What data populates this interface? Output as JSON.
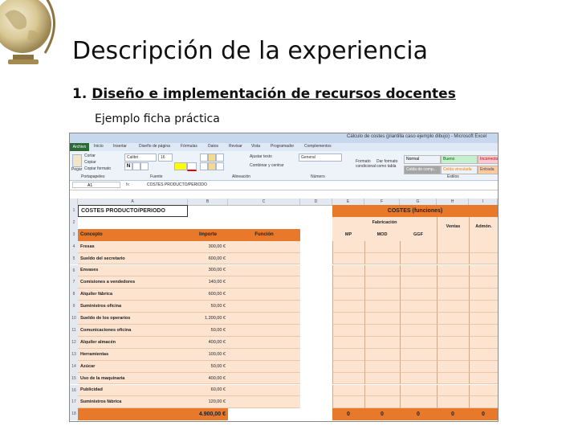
{
  "slide": {
    "title": "Descripción de la experiencia",
    "bullet_number": "1.",
    "bullet_text": "Diseño e implementación de recursos docentes",
    "subtitle": "Ejemplo ficha práctica"
  },
  "excel": {
    "window_title": "Cálculo de costes (plantilla caso ejemplo dibujo) - Microsoft Excel",
    "tabs": [
      "Archivo",
      "Inicio",
      "Insertar",
      "Diseño de página",
      "Fórmulas",
      "Datos",
      "Revisar",
      "Vista",
      "Programador",
      "Complementos"
    ],
    "font_name": "Calibri",
    "font_size": "16",
    "number_format": "General",
    "ribbon": {
      "cut": "Cortar",
      "copy": "Copiar",
      "format_painter": "Copiar formato",
      "paste": "Pegar",
      "wrap": "Ajustar texto",
      "merge": "Combinar y centrar",
      "cond_format": "Formato condicional",
      "as_table": "Dar formato como tabla",
      "group_clipboard": "Portapapeles",
      "group_font": "Fuente",
      "group_alignment": "Alineación",
      "group_number": "Número",
      "group_styles": "Estilos"
    },
    "styles": [
      {
        "label": "Normal",
        "bg": "#ffffff",
        "color": "#222222"
      },
      {
        "label": "Bueno",
        "bg": "#c6efce",
        "color": "#006100"
      },
      {
        "label": "Incorrecto",
        "bg": "#ffc7ce",
        "color": "#9c0006"
      },
      {
        "label": "Celda de comp...",
        "bg": "#a5a5a5",
        "color": "#ffffff"
      },
      {
        "label": "Celda vinculada",
        "bg": "#ffffff",
        "color": "#fa7d00"
      },
      {
        "label": "Entrada",
        "bg": "#ffcc99",
        "color": "#3f3f76"
      }
    ],
    "name_box": "A1",
    "fx": "fx",
    "formula_value": "COSTES PRODUCTO/PERIODO",
    "columns": [
      "A",
      "B",
      "C",
      "D",
      "E",
      "F",
      "G",
      "H",
      "I"
    ],
    "header_title": "COSTES PRODUCTO/PERIODO",
    "funciones_title": "COSTES (funciones)",
    "fabricacion": "Fabricación",
    "ventas": "Ventas",
    "administracion": "Admón.",
    "col_headers": {
      "concepto": "Concepto",
      "importe": "Importe",
      "funcion": "Función",
      "mp": "MP",
      "mod": "MOD",
      "ggf": "GGF"
    },
    "rows": [
      {
        "concepto": "Fresas",
        "importe": "300,00 €"
      },
      {
        "concepto": "Sueldo del secretario",
        "importe": "600,00 €"
      },
      {
        "concepto": "Envases",
        "importe": "300,00 €"
      },
      {
        "concepto": "Comisiones a vendedores",
        "importe": "140,00 €"
      },
      {
        "concepto": "Alquiler fábrica",
        "importe": "600,00 €"
      },
      {
        "concepto": "Suministros oficina",
        "importe": "50,00 €"
      },
      {
        "concepto": "Sueldo de los operarios",
        "importe": "1.200,00 €"
      },
      {
        "concepto": "Comunicaciones oficina",
        "importe": "50,00 €"
      },
      {
        "concepto": "Alquiler almacén",
        "importe": "400,00 €"
      },
      {
        "concepto": "Herramientas",
        "importe": "100,00 €"
      },
      {
        "concepto": "Azúcar",
        "importe": "50,00 €"
      },
      {
        "concepto": "Uso de la maquinaria",
        "importe": "400,00 €"
      },
      {
        "concepto": "Publicidad",
        "importe": "60,00 €"
      },
      {
        "concepto": "Suministros fábrica",
        "importe": "120,00 €"
      }
    ],
    "total": "4.900,00 €",
    "zeros": [
      "0",
      "0",
      "0",
      "0",
      "0"
    ]
  },
  "colors": {
    "orange": "#e8782a",
    "peach": "#fce4d0",
    "ribbon": "#eef3fa"
  }
}
